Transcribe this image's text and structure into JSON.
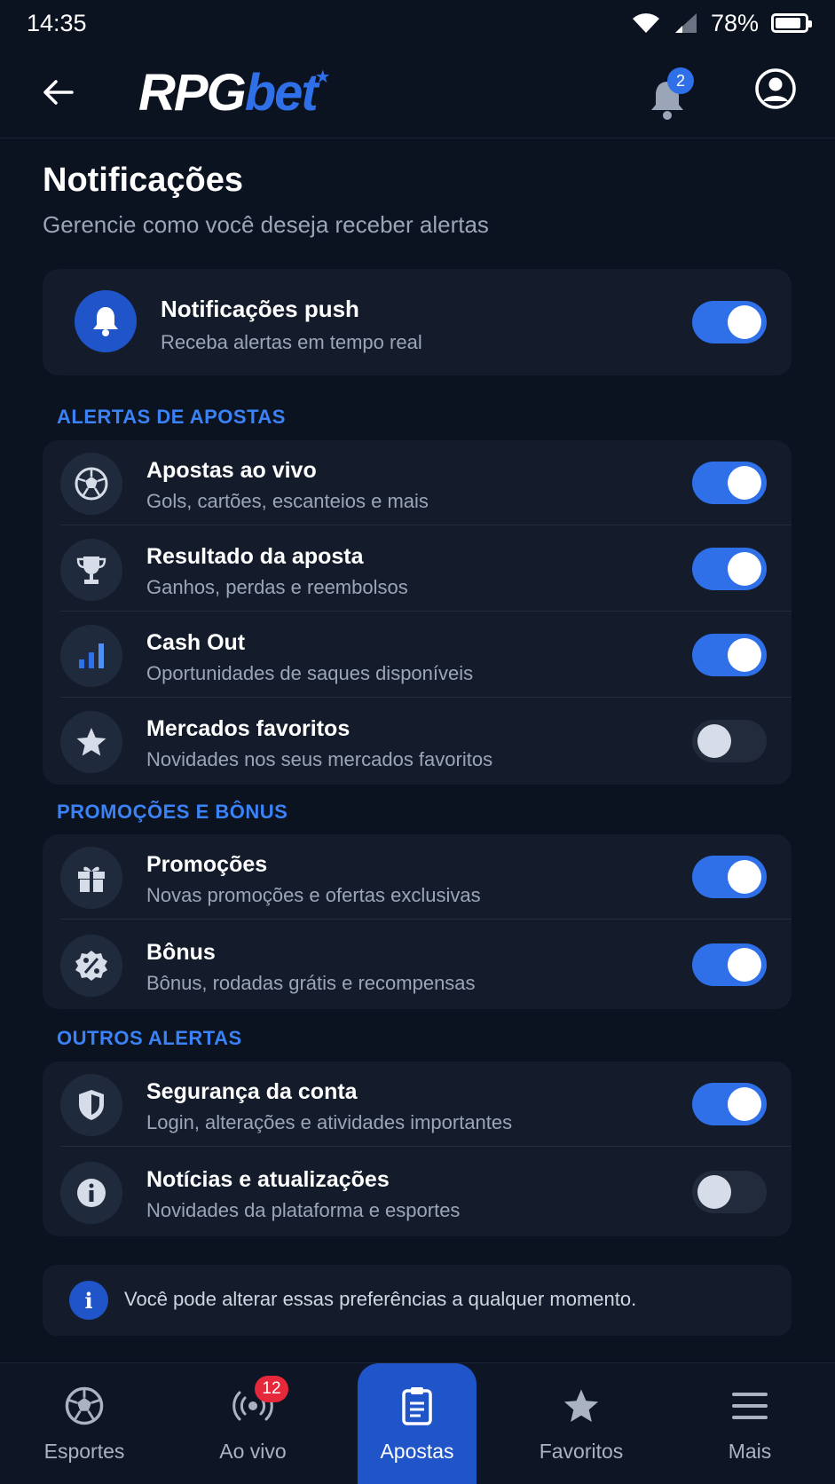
{
  "status": {
    "time": "14:35",
    "battery": "78%"
  },
  "header": {
    "logo_rpg": "RPG",
    "logo_bet": "bet",
    "notif_count": "2"
  },
  "page": {
    "title": "Notificações",
    "subtitle": "Gerencie como você deseja receber alertas"
  },
  "push": {
    "title": "Notificações push",
    "desc": "Receba alertas em tempo real",
    "enabled": true
  },
  "sections": {
    "bets": "ALERTAS DE APOSTAS",
    "promos": "PROMOÇÕES E BÔNUS",
    "others": "OUTROS ALERTAS"
  },
  "bets": [
    {
      "title": "Apostas ao vivo",
      "desc": "Gols, cartões, escanteios e mais",
      "icon": "soccer-ball-icon",
      "enabled": true
    },
    {
      "title": "Resultado da aposta",
      "desc": "Ganhos, perdas e reembolsos",
      "icon": "trophy-icon",
      "enabled": true
    },
    {
      "title": "Cash Out",
      "desc": "Oportunidades de saques disponíveis",
      "icon": "bar-chart-icon",
      "enabled": true
    },
    {
      "title": "Mercados favoritos",
      "desc": "Novidades nos seus mercados favoritos",
      "icon": "star-icon",
      "enabled": false
    }
  ],
  "promos": [
    {
      "title": "Promoções",
      "desc": "Novas promoções e ofertas exclusivas",
      "icon": "gift-icon",
      "enabled": true
    },
    {
      "title": "Bônus",
      "desc": "Bônus, rodadas grátis e recompensas",
      "icon": "percent-badge-icon",
      "enabled": true
    }
  ],
  "others": [
    {
      "title": "Segurança da conta",
      "desc": "Login, alterações e atividades importantes",
      "icon": "shield-icon",
      "enabled": true
    },
    {
      "title": "Notícias e atualizações",
      "desc": "Novidades da plataforma e esportes",
      "icon": "info-icon",
      "enabled": false
    }
  ],
  "info_note": "Você pode alterar essas preferências a qualquer momento.",
  "nav": {
    "sports": "Esportes",
    "live": "Ao vivo",
    "live_badge": "12",
    "bets": "Apostas",
    "favorites": "Favoritos",
    "more": "Mais"
  },
  "colors": {
    "accent": "#2f6fe8",
    "background": "#0b1220",
    "card": "#141c2b",
    "badge_red": "#e5283a"
  }
}
